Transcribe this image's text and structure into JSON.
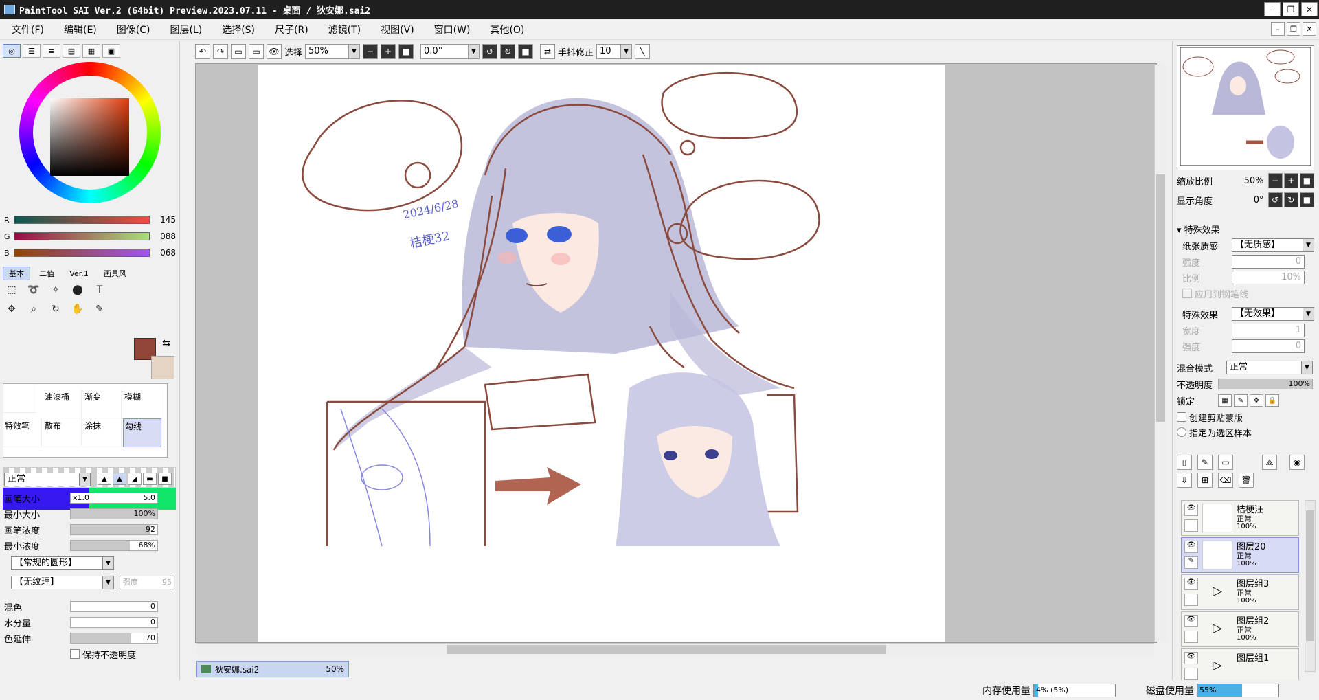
{
  "window": {
    "title": "PaintTool SAI Ver.2 (64bit) Preview.2023.07.11 - 桌面 / 狄安娜.sai2",
    "min_label": "–",
    "restore_label": "❐",
    "close_label": "✕"
  },
  "menu": [
    "文件(F)",
    "编辑(E)",
    "图像(C)",
    "图层(L)",
    "选择(S)",
    "尺子(R)",
    "滤镜(T)",
    "视图(V)",
    "窗口(W)",
    "其他(O)"
  ],
  "color_panel": {
    "rgb": [
      {
        "label": "R",
        "value": "145",
        "color": "#914438"
      },
      {
        "label": "G",
        "value": "088",
        "color": "#5ad05a"
      },
      {
        "label": "B",
        "value": "068",
        "color": "#6e2fe0"
      }
    ],
    "fg_color": "#914438",
    "bg_color": "#e5d4c3"
  },
  "brush_tabs": [
    "基本",
    "二值",
    "Ver.1",
    "画具风"
  ],
  "brushes": [
    "油漆桶",
    "渐变",
    "模糊",
    "特效笔",
    "散布",
    "涂抹",
    "勾线"
  ],
  "blend": {
    "mode": "正常"
  },
  "brush_props": {
    "size_label": "画笔大小",
    "size_mult": "x1.0",
    "size_value": "5.0",
    "min_size_label": "最小大小",
    "min_size_value": "100%",
    "min_size_fill": 1.0,
    "density_label": "画笔浓度",
    "density_value": "92",
    "density_fill": 0.92,
    "min_density_label": "最小浓度",
    "min_density_value": "68%",
    "min_density_fill": 0.68,
    "shape": "【常规的圆形】",
    "texture": "【无纹理】",
    "texture_strength": "强度",
    "texture_value": "95",
    "blend_label": "混色",
    "blend_value": "0",
    "water_label": "水分量",
    "water_value": "0",
    "extend_label": "色延伸",
    "extend_value": "70",
    "extend_fill": 0.7,
    "keep_opacity": "保持不透明度"
  },
  "toolbar": {
    "select_label": "选择",
    "zoom": "50%",
    "angle": "0.0°",
    "stabilizer_label": "手抖修正",
    "stabilizer_value": "10"
  },
  "canvas": {
    "texts": [
      "2024/6/28",
      "桔梗32"
    ]
  },
  "file_tab": {
    "name": "狄安娜.sai2",
    "zoom": "50%"
  },
  "navigator": {
    "zoom_label": "缩放比例",
    "zoom_value": "50%",
    "angle_label": "显示角度",
    "angle_value": "0°"
  },
  "effects": {
    "header": "▾ 特殊效果",
    "paper_label": "纸张质感",
    "paper_value": "【无质感】",
    "strength_label": "强度",
    "strength_value": "0",
    "ratio_label": "比例",
    "ratio_value": "10%",
    "apply_pen": "应用到钢笔线",
    "fx_label": "特殊效果",
    "fx_value": "【无效果】",
    "width_label": "宽度",
    "width_value": "1",
    "strength2_label": "强度",
    "strength2_value": "0"
  },
  "layer_props": {
    "blend_label": "混合模式",
    "blend_value": "正常",
    "opacity_label": "不透明度",
    "opacity_value": "100%",
    "lock_label": "锁定",
    "clip_label": "创建剪贴蒙版",
    "ref_label": "指定为选区样本"
  },
  "layers": [
    {
      "name": "桔梗汪",
      "mode": "正常",
      "opacity": "100%",
      "selected": false,
      "group": false
    },
    {
      "name": "图层20",
      "mode": "正常",
      "opacity": "100%",
      "selected": true,
      "group": false
    },
    {
      "name": "图层组3",
      "mode": "正常",
      "opacity": "100%",
      "selected": false,
      "group": true
    },
    {
      "name": "图层组2",
      "mode": "正常",
      "opacity": "100%",
      "selected": false,
      "group": true
    },
    {
      "name": "图层组1",
      "mode": "",
      "opacity": "",
      "selected": false,
      "group": true
    }
  ],
  "status": {
    "mem_label": "内存使用量",
    "mem_value": "4% (5%)",
    "mem_fill": 0.05,
    "disk_label": "磁盘使用量",
    "disk_value": "55%",
    "disk_fill": 0.55
  }
}
